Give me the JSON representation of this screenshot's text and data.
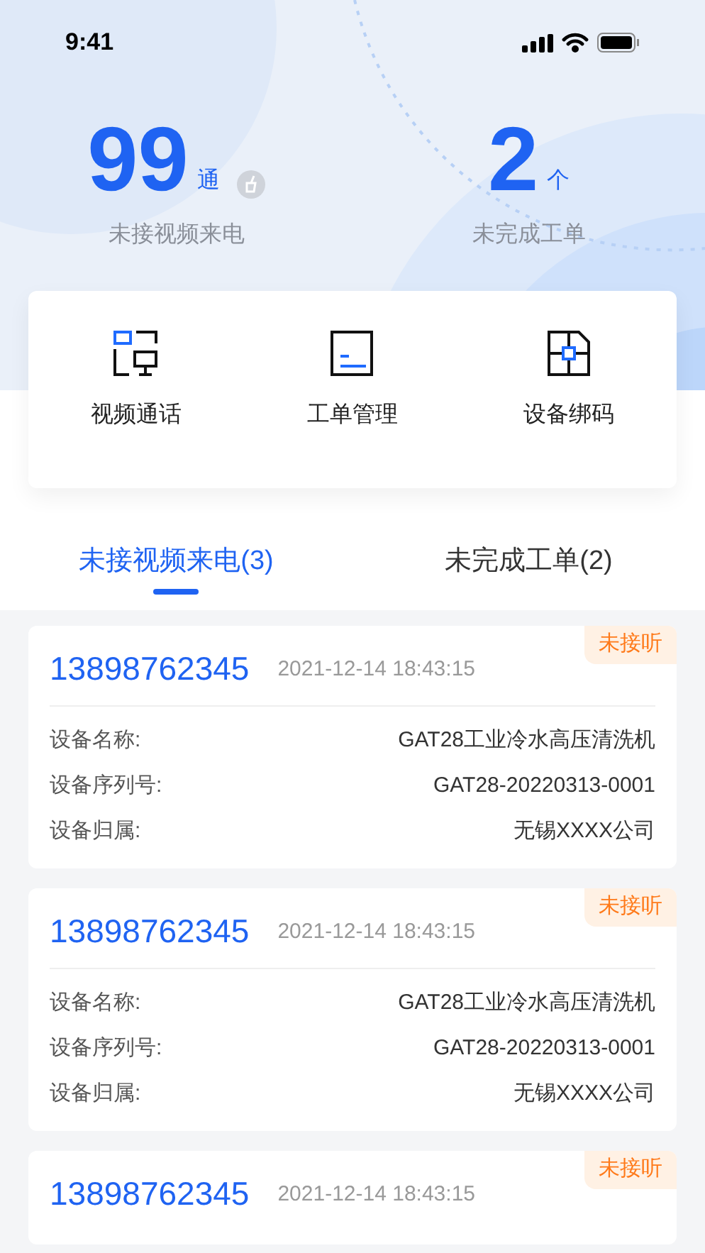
{
  "status_bar": {
    "time": "9:41"
  },
  "stats": [
    {
      "value": "99",
      "unit": "通",
      "label": "未接视频来电",
      "clear_icon": true
    },
    {
      "value": "2",
      "unit": "个",
      "label": "未完成工单",
      "clear_icon": false
    }
  ],
  "shortcuts": [
    {
      "kind": "video",
      "label": "视频通话"
    },
    {
      "kind": "order",
      "label": "工单管理"
    },
    {
      "kind": "bind",
      "label": "设备绑码"
    }
  ],
  "tabs": [
    {
      "label": "未接视频来电(3)",
      "selected": true
    },
    {
      "label": "未完成工单(2)",
      "selected": false
    }
  ],
  "calls": [
    {
      "phone": "13898762345",
      "time": "2021-12-14 18:43:15",
      "status": "未接听",
      "fields": [
        {
          "label": "设备名称:",
          "value": "GAT28工业冷水高压清洗机"
        },
        {
          "label": "设备序列号:",
          "value": "GAT28-20220313-0001"
        },
        {
          "label": "设备归属:",
          "value": "无锡XXXX公司"
        }
      ]
    },
    {
      "phone": "13898762345",
      "time": "2021-12-14 18:43:15",
      "status": "未接听",
      "fields": [
        {
          "label": "设备名称:",
          "value": "GAT28工业冷水高压清洗机"
        },
        {
          "label": "设备序列号:",
          "value": "GAT28-20220313-0001"
        },
        {
          "label": "设备归属:",
          "value": "无锡XXXX公司"
        }
      ]
    },
    {
      "phone": "13898762345",
      "time": "2021-12-14 18:43:15",
      "status": "未接听"
    }
  ]
}
